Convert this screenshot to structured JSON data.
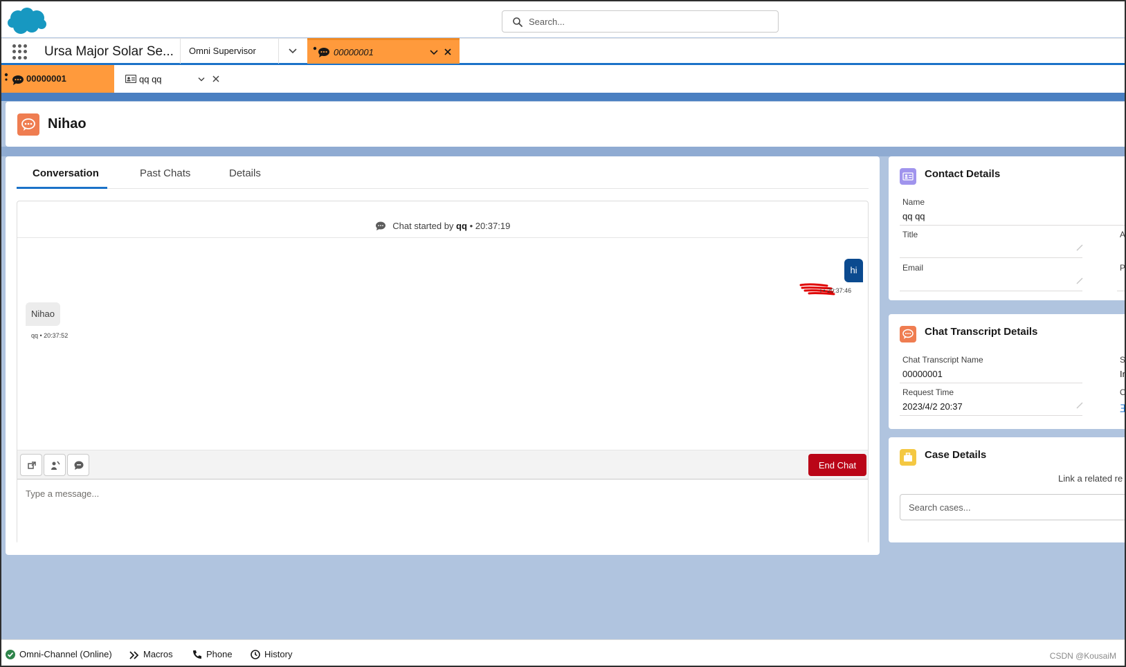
{
  "header": {
    "search_placeholder": "Search..."
  },
  "nav": {
    "app_name": "Ursa Major Solar Se...",
    "items": [
      {
        "label": "Omni Supervisor"
      }
    ],
    "workspace_tab": {
      "label": "00000001"
    }
  },
  "subtabs": [
    {
      "label": "00000001"
    },
    {
      "label": "qq qq"
    }
  ],
  "record": {
    "title": "Nihao"
  },
  "conversation": {
    "tabs": [
      {
        "label": "Conversation"
      },
      {
        "label": "Past Chats"
      },
      {
        "label": "Details"
      }
    ],
    "chat_started": {
      "prefix": "Chat started by",
      "user": "qq",
      "time": "• 20:37:19"
    },
    "messages": [
      {
        "direction": "outgoing",
        "text": "hi",
        "meta": "i • 20:37:46"
      },
      {
        "direction": "incoming",
        "text": "Nihao",
        "meta": "qq • 20:37:52"
      }
    ],
    "end_chat_label": "End Chat",
    "composer_placeholder": "Type a message..."
  },
  "contact_details": {
    "title": "Contact Details",
    "fields": [
      {
        "label": "Name",
        "value": "qq qq"
      },
      {
        "label": "Title",
        "value": ""
      },
      {
        "label": "Email",
        "value": ""
      }
    ],
    "cut_labels": [
      "A",
      "Pl"
    ]
  },
  "transcript_details": {
    "title": "Chat Transcript Details",
    "fields": [
      {
        "label": "Chat Transcript Name",
        "value": "00000001"
      },
      {
        "label": "Request Time",
        "value": "2023/4/2 20:37"
      }
    ],
    "cut_labels": [
      "St",
      "In",
      "O",
      "王"
    ]
  },
  "case_details": {
    "title": "Case Details",
    "link_text": "Link a related re",
    "search_placeholder": "Search cases..."
  },
  "utility_bar": {
    "items": [
      {
        "label": "Omni-Channel (Online)"
      },
      {
        "label": "Macros"
      },
      {
        "label": "Phone"
      },
      {
        "label": "History"
      }
    ],
    "watermark": "CSDN @KousaiM"
  },
  "colors": {
    "brand_blue": "#1b72c8",
    "active_tab_orange": "#ff9a3c",
    "end_chat_red": "#ba0517",
    "outgoing_bubble": "#0b4a8f",
    "page_background": "#b0c4df",
    "online_green": "#2e844a"
  }
}
